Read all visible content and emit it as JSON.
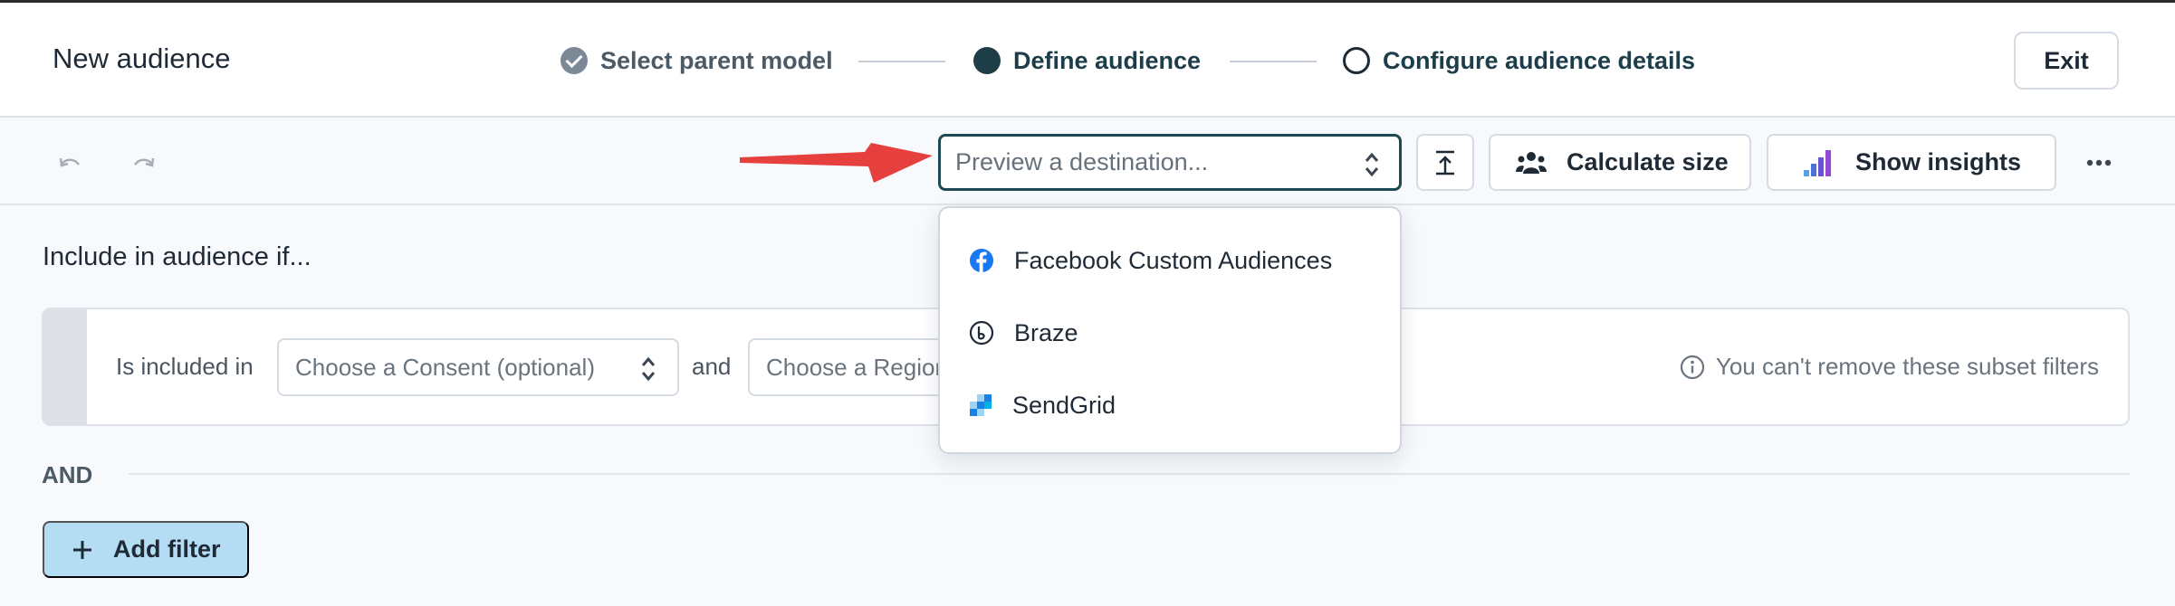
{
  "header": {
    "title": "New audience",
    "steps": [
      {
        "label": "Select parent model",
        "state": "completed"
      },
      {
        "label": "Define audience",
        "state": "current"
      },
      {
        "label": "Configure audience details",
        "state": "upcoming"
      }
    ],
    "exit_label": "Exit"
  },
  "toolbar": {
    "undo_icon": "undo-icon",
    "redo_icon": "redo-icon",
    "preview_placeholder": "Preview a destination...",
    "calculate_size_label": "Calculate size",
    "show_insights_label": "Show insights"
  },
  "destination_menu": {
    "items": [
      {
        "label": "Facebook Custom Audiences",
        "icon": "facebook-icon"
      },
      {
        "label": "Braze",
        "icon": "braze-icon"
      },
      {
        "label": "SendGrid",
        "icon": "sendgrid-icon"
      }
    ]
  },
  "main": {
    "heading": "Include in audience if...",
    "subset": {
      "included_label": "Is included in",
      "consent_placeholder": "Choose a Consent (optional)",
      "and_label": "and",
      "region_placeholder": "Choose a Region",
      "note": "You can't remove these subset filters"
    },
    "and_separator": "AND",
    "add_filter_label": "Add filter"
  },
  "colors": {
    "accent": "#1d3e46",
    "add_filter_bg": "#b4ddf4",
    "arrow": "#e5403d",
    "facebook": "#1877f2"
  }
}
